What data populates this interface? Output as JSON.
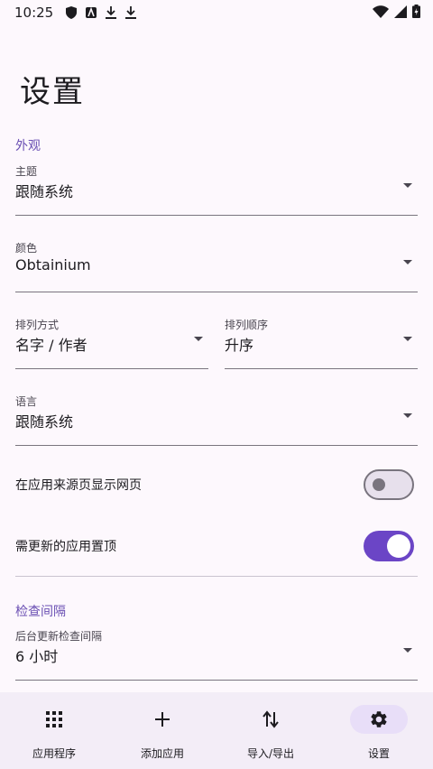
{
  "status_bar": {
    "time": "10:25"
  },
  "page_title": "设置",
  "sections": {
    "appearance": "外观",
    "check_interval": "检查间隔"
  },
  "fields": {
    "theme": {
      "label": "主题",
      "value": "跟随系统"
    },
    "color": {
      "label": "颜色",
      "value": "Obtainium"
    },
    "sort_by": {
      "label": "排列方式",
      "value": "名字 / 作者"
    },
    "sort_order": {
      "label": "排列顺序",
      "value": "升序"
    },
    "language": {
      "label": "语言",
      "value": "跟随系统"
    },
    "bg_interval": {
      "label": "后台更新检查间隔",
      "value": "6 小时"
    }
  },
  "toggles": {
    "show_webpage": {
      "label": "在应用来源页显示网页",
      "on": false
    },
    "pin_updates": {
      "label": "需更新的应用置顶",
      "on": true
    }
  },
  "bottom_nav": {
    "apps": "应用程序",
    "add_app": "添加应用",
    "import_export": "导入/导出",
    "settings": "设置"
  },
  "colors": {
    "accent": "#6b45c6",
    "nav_bg": "#f3edf7",
    "nav_active": "#e8def8"
  }
}
